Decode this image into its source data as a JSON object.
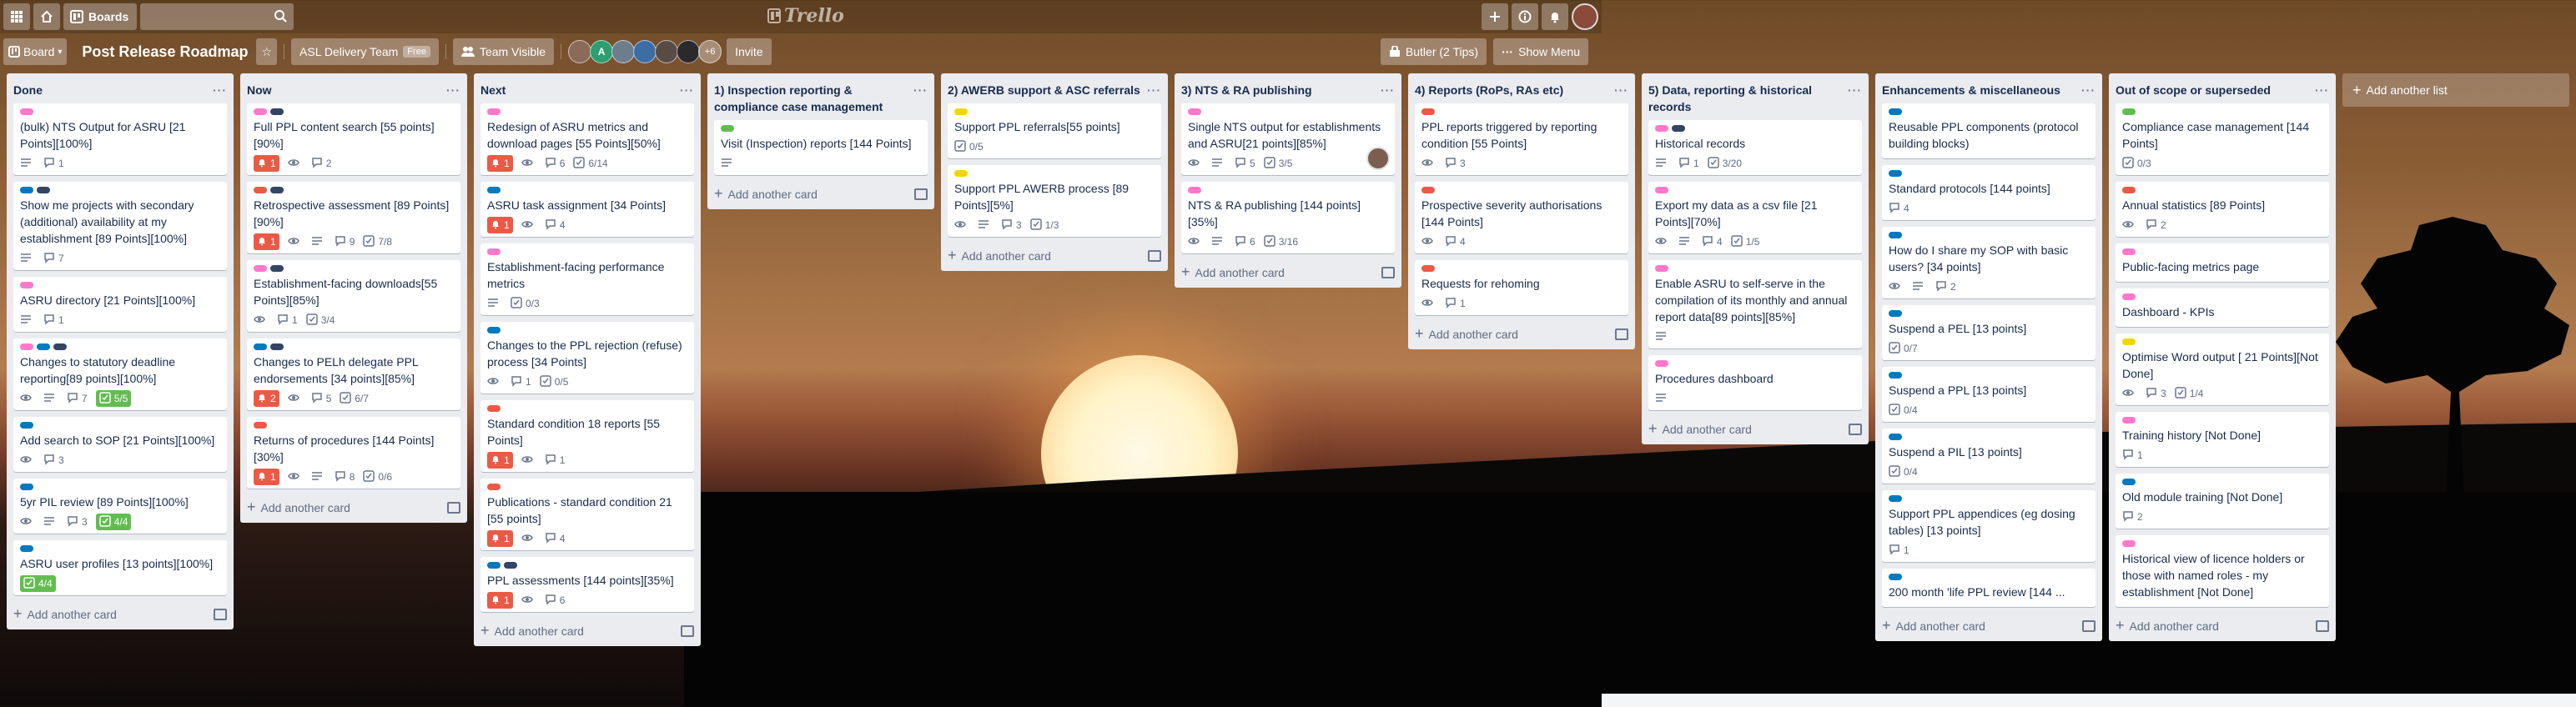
{
  "topbar": {
    "boards_label": "Boards",
    "logo_text": "Trello",
    "icons": [
      "apps-icon",
      "home-icon",
      "search-icon",
      "plus-icon",
      "info-icon",
      "bell-icon"
    ]
  },
  "board": {
    "view_label": "Board",
    "name": "Post Release Roadmap",
    "team_name": "ASL Delivery Team",
    "team_badge": "Free",
    "visibility_label": "Team Visible",
    "member_initial": "A",
    "member_extra_count": "+6",
    "invite_label": "Invite",
    "butler_label": "Butler (2 Tips)",
    "menu_label": "Show Menu"
  },
  "add_card_label": "Add another card",
  "add_list_label": "Add another list",
  "lists": [
    {
      "title": "Done",
      "cards": [
        {
          "labels": [
            "pink"
          ],
          "title": "(bulk) NTS Output for ASRU [21 Points][100%]",
          "desc": true,
          "comments": "1"
        },
        {
          "labels": [
            "blue",
            "navy"
          ],
          "title": "Show me projects with secondary (additional) availability at my establishment [89 Points][100%]",
          "desc": true,
          "comments": "7"
        },
        {
          "labels": [
            "pink"
          ],
          "title": "ASRU directory [21 Points][100%]",
          "desc": true,
          "comments": "1"
        },
        {
          "labels": [
            "pink",
            "blue",
            "navy"
          ],
          "title": "Changes to statutory deadline reporting[89 points][100%]",
          "watch": true,
          "desc": true,
          "comments": "7",
          "checklist": "5/5",
          "checklist_done": true
        },
        {
          "labels": [
            "blue"
          ],
          "title": "Add search to SOP [21 Points][100%]",
          "watch": true,
          "comments": "3"
        },
        {
          "labels": [
            "blue"
          ],
          "title": "5yr PIL review [89 Points][100%]",
          "watch": true,
          "desc": true,
          "comments": "3",
          "checklist": "4/4",
          "checklist_done": true
        },
        {
          "labels": [
            "blue"
          ],
          "title": "ASRU user profiles [13 points][100%]",
          "checklist": "4/4",
          "checklist_done": true
        }
      ]
    },
    {
      "title": "Now",
      "cards": [
        {
          "labels": [
            "pink",
            "navy"
          ],
          "title": "Full PPL content search [55 points][90%]",
          "due": "1",
          "watch": true,
          "comments": "2"
        },
        {
          "labels": [
            "red",
            "navy"
          ],
          "title": "Retrospective assessment [89 Points][90%]",
          "due": "1",
          "watch": true,
          "desc": true,
          "comments": "9",
          "checklist": "7/8"
        },
        {
          "labels": [
            "pink",
            "navy"
          ],
          "title": "Establishment-facing downloads[55 Points][85%]",
          "watch": true,
          "comments": "1",
          "checklist": "3/4"
        },
        {
          "labels": [
            "blue",
            "navy"
          ],
          "title": "Changes to PELh delegate PPL endorsements [34 points][85%]",
          "due": "2",
          "watch": true,
          "comments": "5",
          "checklist": "6/7"
        },
        {
          "labels": [
            "red"
          ],
          "title": "Returns of procedures [144 Points][30%]",
          "due": "1",
          "watch": true,
          "desc": true,
          "comments": "8",
          "checklist": "0/6"
        }
      ]
    },
    {
      "title": "Next",
      "cards": [
        {
          "labels": [
            "pink"
          ],
          "title": "Redesign of ASRU metrics and download pages [55 Points][50%]",
          "due": "1",
          "watch": true,
          "comments": "6",
          "checklist": "6/14"
        },
        {
          "labels": [
            "blue"
          ],
          "title": "ASRU task assignment [34 Points]",
          "due": "1",
          "watch": true,
          "comments": "4"
        },
        {
          "labels": [
            "pink"
          ],
          "title": "Establishment-facing performance metrics",
          "desc": true,
          "checklist": "0/3"
        },
        {
          "labels": [
            "blue"
          ],
          "title": "Changes to the PPL rejection (refuse) process [34 Points]",
          "watch": true,
          "comments": "1",
          "checklist": "0/5"
        },
        {
          "labels": [
            "red"
          ],
          "title": "Standard condition 18 reports [55 Points]",
          "due": "1",
          "watch": true,
          "comments": "1"
        },
        {
          "labels": [
            "red"
          ],
          "title": "Publications - standard condition 21 [55 points]",
          "due": "1",
          "watch": true,
          "comments": "4"
        },
        {
          "labels": [
            "blue",
            "navy"
          ],
          "title": "PPL assessments [144 points][35%]",
          "due": "1",
          "watch": true,
          "comments": "6"
        }
      ]
    },
    {
      "title": "1) Inspection reporting & compliance case management",
      "cards": [
        {
          "labels": [
            "green"
          ],
          "title": "Visit (Inspection) reports [144 Points]",
          "desc": true
        }
      ]
    },
    {
      "title": "2) AWERB support & ASC referrals",
      "cards": [
        {
          "labels": [
            "yellow"
          ],
          "title": "Support PPL referrals[55 points]",
          "checklist": "0/5"
        },
        {
          "labels": [
            "yellow"
          ],
          "title": "Support PPL AWERB process [89 Points][5%]",
          "watch": true,
          "desc": true,
          "comments": "3",
          "checklist": "1/3"
        }
      ]
    },
    {
      "title": "3) NTS & RA publishing",
      "cards": [
        {
          "labels": [
            "pink"
          ],
          "title": "Single NTS output for establishments and ASRU[21 points][85%]",
          "watch": true,
          "desc": true,
          "comments": "5",
          "checklist": "3/5",
          "avatar": true
        },
        {
          "labels": [
            "pink"
          ],
          "title": "NTS & RA publishing [144 points][35%]",
          "watch": true,
          "desc": true,
          "comments": "6",
          "checklist": "3/16"
        }
      ]
    },
    {
      "title": "4) Reports (RoPs, RAs etc)",
      "cards": [
        {
          "labels": [
            "red"
          ],
          "title": "PPL reports triggered by reporting condition [55 Points]",
          "watch": true,
          "comments": "3"
        },
        {
          "labels": [
            "red"
          ],
          "title": "Prospective severity authorisations [144 Points]",
          "watch": true,
          "comments": "4"
        },
        {
          "labels": [
            "red"
          ],
          "title": "Requests for rehoming",
          "watch": true,
          "comments": "1"
        }
      ]
    },
    {
      "title": "5) Data, reporting & historical records",
      "cards": [
        {
          "labels": [
            "pink",
            "navy"
          ],
          "title": "Historical records",
          "desc": true,
          "comments": "1",
          "checklist": "3/20"
        },
        {
          "labels": [
            "pink"
          ],
          "title": "Export my data as a csv file [21 Points][70%]",
          "watch": true,
          "desc": true,
          "comments": "4",
          "checklist": "1/5"
        },
        {
          "labels": [
            "pink"
          ],
          "title": "Enable ASRU to self-serve in the compilation of its monthly and annual report data[89 points][85%]",
          "desc": true
        },
        {
          "labels": [
            "pink"
          ],
          "title": "Procedures dashboard",
          "desc": true
        }
      ]
    },
    {
      "title": "Enhancements & miscellaneous",
      "cards": [
        {
          "labels": [
            "blue"
          ],
          "title": "Reusable PPL components (protocol building blocks)"
        },
        {
          "labels": [
            "blue"
          ],
          "title": "Standard protocols [144 points]",
          "comments": "4"
        },
        {
          "labels": [
            "blue"
          ],
          "title": "How do I share my SOP with basic users? [34 points]",
          "watch": true,
          "desc": true,
          "comments": "2"
        },
        {
          "labels": [
            "blue"
          ],
          "title": "Suspend a PEL [13 points]",
          "checklist": "0/7"
        },
        {
          "labels": [
            "blue"
          ],
          "title": "Suspend a PPL [13 points]",
          "checklist": "0/4"
        },
        {
          "labels": [
            "blue"
          ],
          "title": "Suspend a PIL [13 points]",
          "checklist": "0/4"
        },
        {
          "labels": [
            "blue"
          ],
          "title": "Support PPL appendices (eg dosing tables) [13 points]",
          "comments": "1"
        },
        {
          "labels": [
            "blue"
          ],
          "title": "200 month 'life PPL review [144 ..."
        }
      ]
    },
    {
      "title": "Out of scope or superseded",
      "cards": [
        {
          "labels": [
            "green"
          ],
          "title": "Compliance case management [144 Points]",
          "checklist": "0/3"
        },
        {
          "labels": [
            "red"
          ],
          "title": "Annual statistics [89 Points]",
          "watch": true,
          "comments": "2"
        },
        {
          "labels": [
            "pink"
          ],
          "title": "Public-facing metrics page"
        },
        {
          "labels": [
            "pink"
          ],
          "title": "Dashboard - KPIs"
        },
        {
          "labels": [
            "yellow"
          ],
          "title": "Optimise Word output [ 21 Points][Not Done]",
          "watch": true,
          "comments": "3",
          "checklist": "1/4"
        },
        {
          "labels": [
            "pink"
          ],
          "title": "Training history [Not Done]",
          "comments": "1"
        },
        {
          "labels": [
            "blue"
          ],
          "title": "Old module training [Not Done]",
          "comments": "2"
        },
        {
          "labels": [
            "pink"
          ],
          "title": "Historical view of licence holders or those with named roles - my establishment [Not Done]"
        }
      ]
    }
  ]
}
